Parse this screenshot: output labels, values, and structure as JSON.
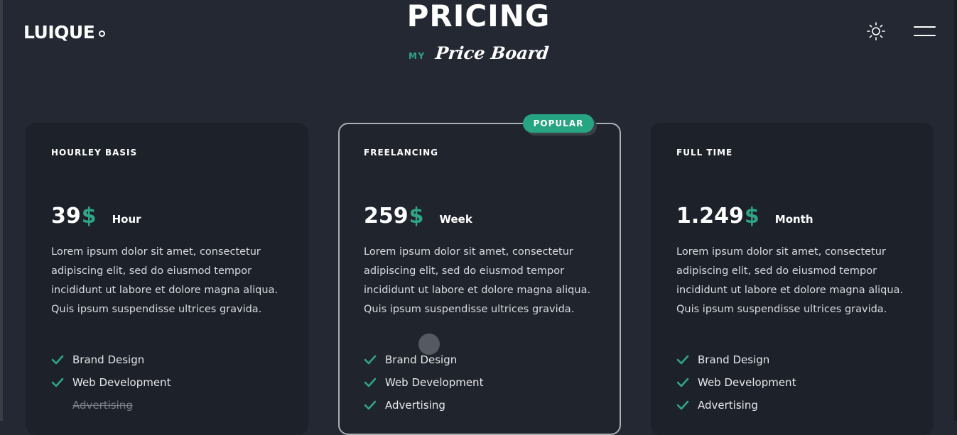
{
  "header": {
    "logo_text": "LUIQUE",
    "section_title": "PRICING",
    "subtitle_small": "MY",
    "subtitle_script": "Price Board",
    "theme_icon": "sun-icon",
    "menu_icon": "hamburger-menu-icon"
  },
  "colors": {
    "background": "#232833",
    "card": "#1d2129",
    "accent": "#2fa585",
    "text": "#ffffff"
  },
  "plans": [
    {
      "name": "HOURLEY BASIS",
      "price": "39",
      "currency": "$",
      "period": "Hour",
      "description": "Lorem ipsum dolor sit amet, consectetur adipiscing elit, sed do eiusmod tempor incididunt ut labore et dolore magna aliqua. Quis ipsum suspendisse ultrices gravida.",
      "features": [
        {
          "label": "Brand Design",
          "included": true
        },
        {
          "label": "Web Development",
          "included": true
        },
        {
          "label": "Advertising",
          "included": false
        }
      ]
    },
    {
      "name": "FREELANCING",
      "price": "259",
      "currency": "$",
      "period": "Week",
      "badge": "POPULAR",
      "description": "Lorem ipsum dolor sit amet, consectetur adipiscing elit, sed do eiusmod tempor incididunt ut labore et dolore magna aliqua. Quis ipsum suspendisse ultrices gravida.",
      "features": [
        {
          "label": "Brand Design",
          "included": true
        },
        {
          "label": "Web Development",
          "included": true
        },
        {
          "label": "Advertising",
          "included": true
        }
      ]
    },
    {
      "name": "FULL TIME",
      "price": "1.249",
      "currency": "$",
      "period": "Month",
      "description": "Lorem ipsum dolor sit amet, consectetur adipiscing elit, sed do eiusmod tempor incididunt ut labore et dolore magna aliqua. Quis ipsum suspendisse ultrices gravida.",
      "features": [
        {
          "label": "Brand Design",
          "included": true
        },
        {
          "label": "Web Development",
          "included": true
        },
        {
          "label": "Advertising",
          "included": true
        }
      ]
    }
  ]
}
